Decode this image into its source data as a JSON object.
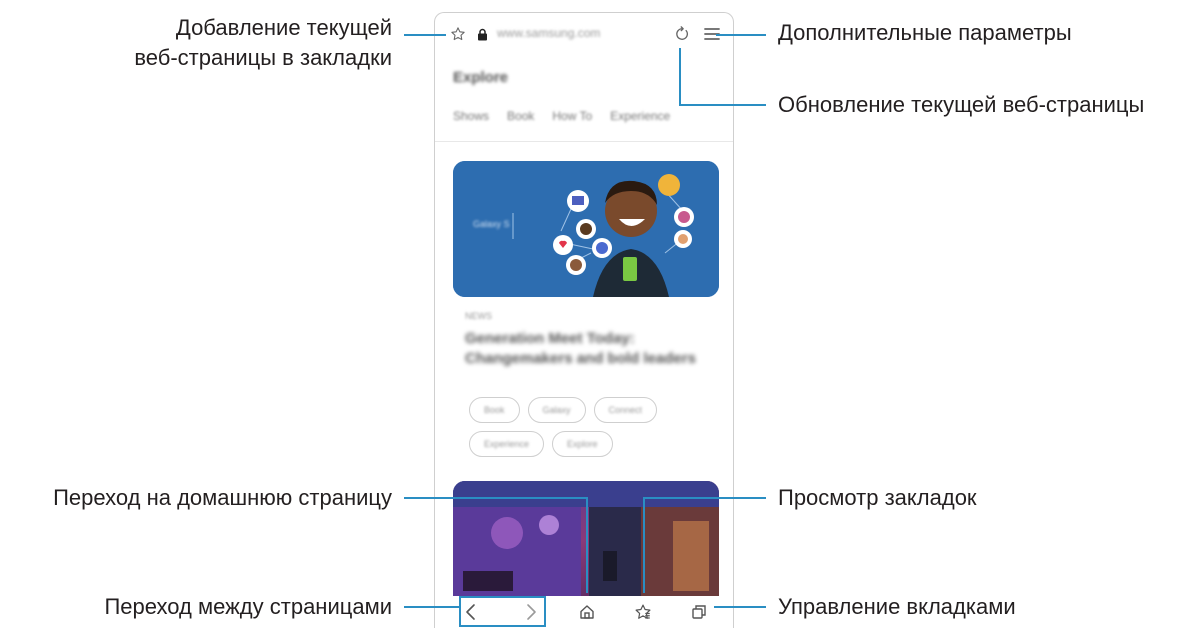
{
  "browser": {
    "url": "www.samsung.com",
    "page_heading": "Explore",
    "tabs": [
      "Shows",
      "Book",
      "How To",
      "Experience"
    ],
    "hero_caption": "Galaxy S",
    "article": {
      "kicker": "NEWS",
      "title": "Generation Meet Today: Changemakers and bold leaders",
      "tags": [
        "Book",
        "Galaxy",
        "Connect",
        "Experience",
        "Explore"
      ]
    }
  },
  "callouts": {
    "bookmark_add": "Добавление текущей\nвеб-страницы в закладки",
    "more_options": "Дополнительные параметры",
    "refresh": "Обновление текущей веб-страницы",
    "home": "Переход на домашнюю страницу",
    "view_bookmarks": "Просмотр закладок",
    "navigate_pages": "Переход между страницами",
    "manage_tabs": "Управление вкладками"
  },
  "icons": {
    "star": "star-icon",
    "lock": "lock-icon",
    "refresh": "refresh-icon",
    "menu": "menu-icon",
    "back": "back-arrow-icon",
    "forward": "forward-arrow-icon",
    "home": "home-icon",
    "bookmarks": "bookmarks-icon",
    "tabs": "tabs-icon"
  },
  "colors": {
    "leader": "#2a8ec3",
    "hero": "#2d6db0",
    "text": "#231f20"
  }
}
